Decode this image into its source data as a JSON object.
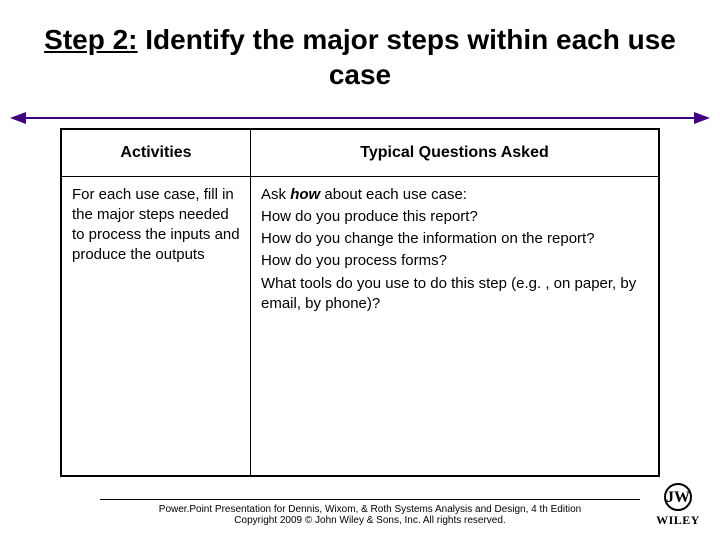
{
  "title": {
    "step_label": "Step 2:",
    "rest": " Identify the major steps within each use case"
  },
  "table": {
    "headers": {
      "activities": "Activities",
      "questions": "Typical Questions Asked"
    },
    "row": {
      "activity": "For each use case, fill in the major steps needed to process the inputs and produce the outputs",
      "q_intro_pre": "Ask ",
      "q_intro_how": "how",
      "q_intro_post": " about each use case:",
      "q1": "How do you produce this report?",
      "q2": "How do you change the information on the report?",
      "q3": "How do you process forms?",
      "q4": "What tools do you use to do this step (e.g. , on paper, by email, by phone)?"
    }
  },
  "footer": {
    "line1": "Power.Point Presentation for Dennis, Wixom, & Roth Systems Analysis and Design, 4 th Edition",
    "line2": "Copyright 2009 © John Wiley & Sons, Inc. All rights reserved."
  },
  "logo": {
    "mark": "JW",
    "text": "WILEY"
  }
}
